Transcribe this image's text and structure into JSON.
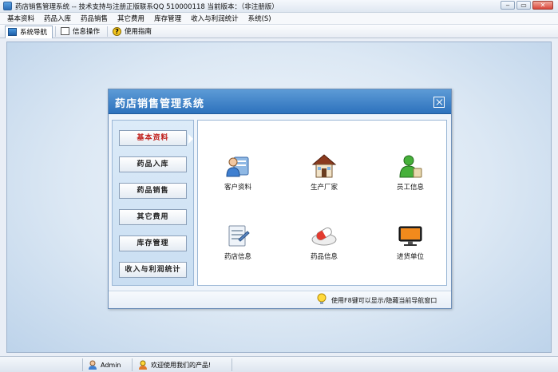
{
  "window": {
    "title": "药店销售管理系统 -- 技术支持与注册正版联系QQ 510000118    当前版本：（非注册版）"
  },
  "menu": [
    "基本资料",
    "药品入库",
    "药品销售",
    "其它费用",
    "库存管理",
    "收入与利润统计",
    "系统(S)"
  ],
  "toolbar": {
    "nav_label": "系统导航",
    "info_label": "信息操作",
    "help_label": "使用指南",
    "help_glyph": "?"
  },
  "nav": {
    "title": "药店销售管理系统",
    "buttons": [
      "基本资料",
      "药品入库",
      "药品销售",
      "其它费用",
      "库存管理",
      "收入与利润统计"
    ],
    "active_index": 0,
    "features": [
      "客户资料",
      "生产厂家",
      "员工信息",
      "药店信息",
      "药品信息",
      "进货单位"
    ],
    "tip": "使用F8键可以显示/隐藏当前导航窗口"
  },
  "status": {
    "user": "Admin",
    "welcome": "欢迎使用我们的产品!"
  },
  "colors": {
    "header_blue": "#2d72bd",
    "active_text": "#c0201c",
    "workspace_bg": "#dce8f4"
  },
  "icons": {
    "customer": "customer-icon",
    "factory": "factory-house-icon",
    "employee": "employee-icon",
    "store": "store-info-icon",
    "medicine": "capsule-icon",
    "supplier": "monitor-icon"
  }
}
